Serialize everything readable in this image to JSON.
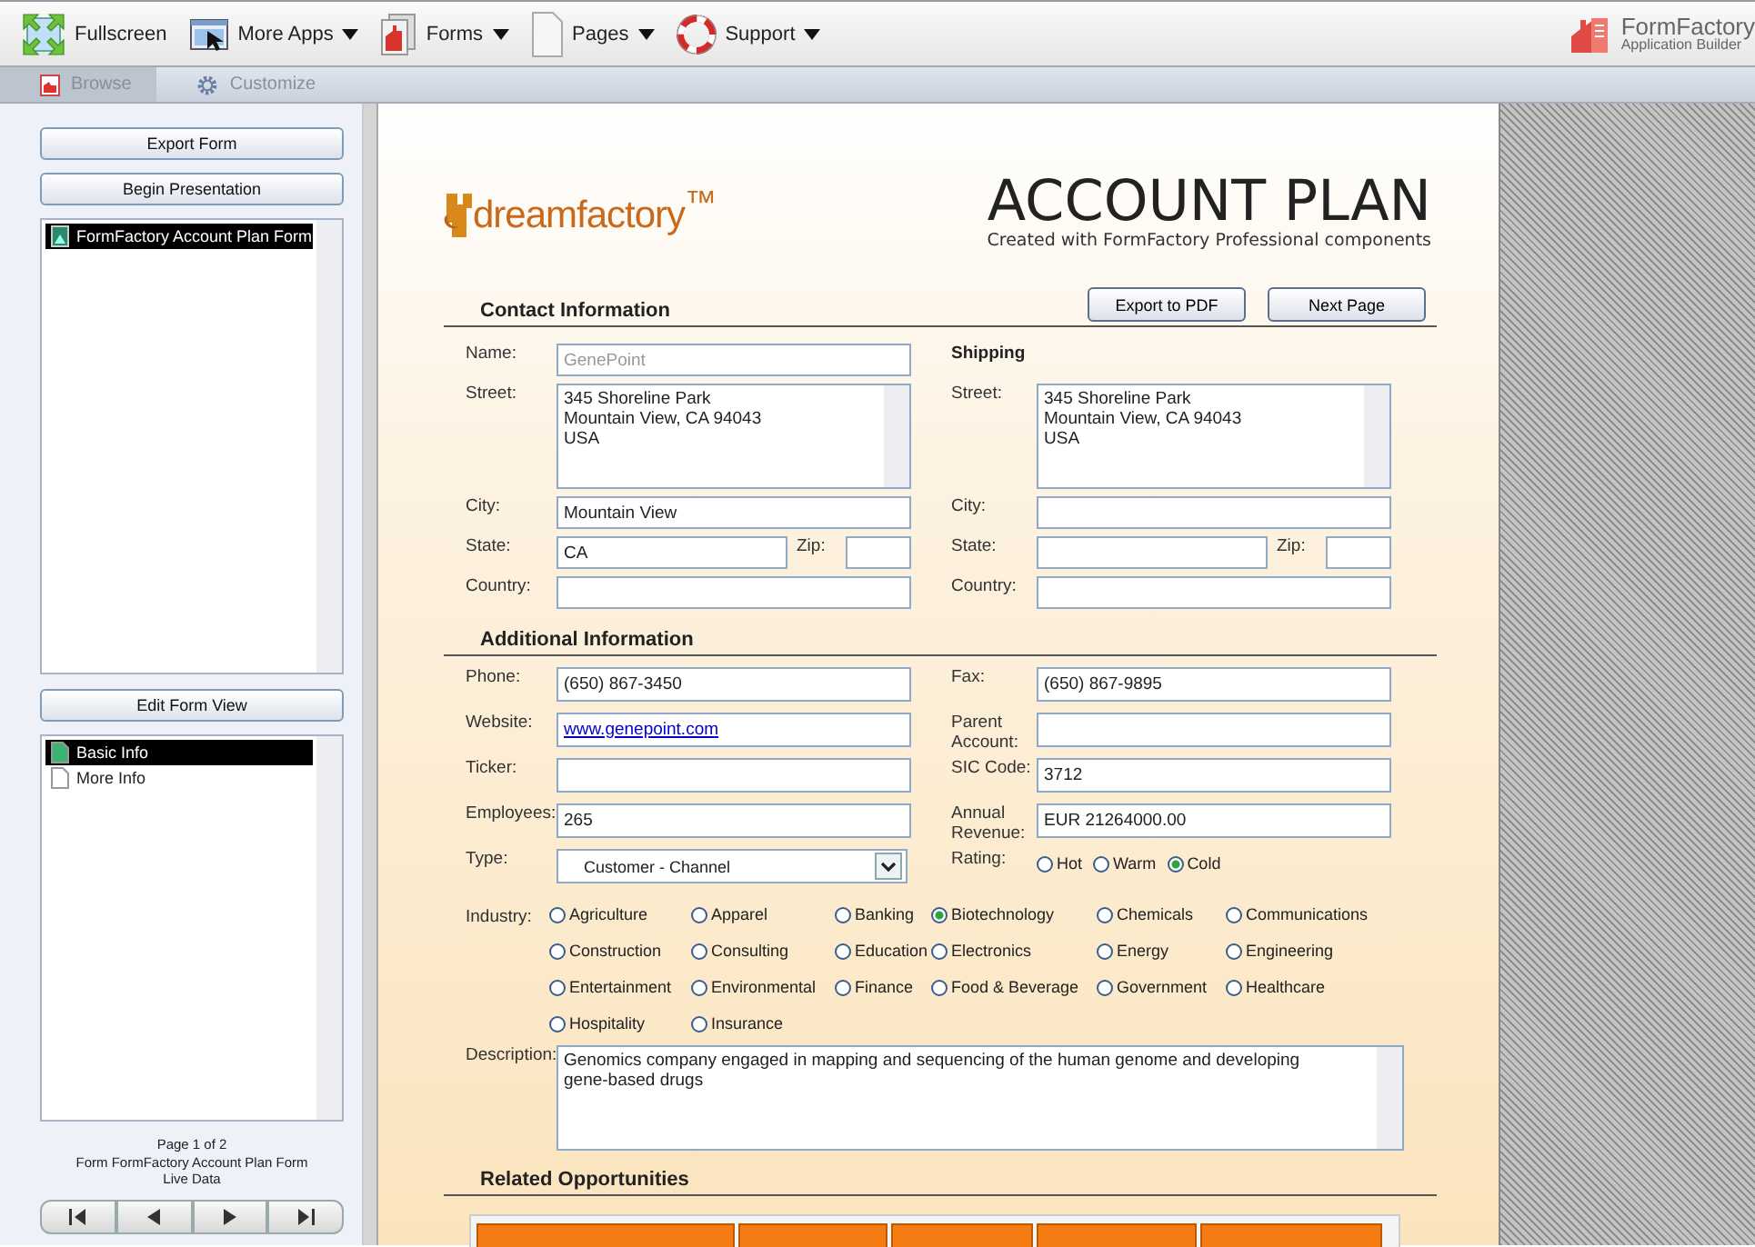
{
  "toolbar": {
    "items": [
      {
        "label": "Fullscreen",
        "kind": "button"
      },
      {
        "label": "More Apps",
        "kind": "menu"
      },
      {
        "label": "Forms",
        "kind": "menu"
      },
      {
        "label": "Pages",
        "kind": "menu"
      },
      {
        "label": "Support",
        "kind": "menu"
      }
    ],
    "brand": {
      "name": "FormFactory",
      "tagline": "Application Builder"
    }
  },
  "tabs": [
    {
      "label": "Browse",
      "selected": true
    },
    {
      "label": "Customize",
      "selected": false
    }
  ],
  "sidebar": {
    "form_actions": [
      "Export Form",
      "Begin Presentation"
    ],
    "forms": [
      {
        "label": "FormFactory Account Plan Form",
        "selected": true
      }
    ],
    "view_action": "Edit Form View",
    "pages": [
      {
        "label": "Basic Info",
        "selected": true
      },
      {
        "label": "More Info",
        "selected": false
      }
    ],
    "footer": [
      "Page 1 of 2",
      "Form FormFactory Account Plan Form",
      "Live Data"
    ]
  },
  "form": {
    "logo": "dreamfactory$^{™}$",
    "title": "ACCOUNT PLAN",
    "subtitle": "Created with FormFactory Professional components",
    "contact": {
      "heading": "Contact Information",
      "buttons": [
        "Export to PDF",
        "Next Page"
      ],
      "billing": [
        {
          "kind": "text",
          "label": "Name:",
          "placeholder": "GenePoint"
        },
        {
          "kind": "area",
          "label": "Street:",
          "value": "345 Shoreline Park\nMountain View, CA 94043\nUSA"
        },
        {
          "kind": "text",
          "label": "City:",
          "value": "Mountain View"
        },
        {
          "kind": "pair",
          "label": "State:",
          "value": "CA",
          "label2": "Zip:"
        },
        {
          "kind": "text",
          "label": "Country:"
        }
      ],
      "shipping_heading": "Shipping",
      "shipping": [
        {
          "kind": "area",
          "label": "Street:",
          "value": "345 Shoreline Park\nMountain View, CA 94043\nUSA"
        },
        {
          "kind": "text",
          "label": "City:"
        },
        {
          "kind": "pair",
          "label": "State:",
          "label2": "Zip:"
        },
        {
          "kind": "text",
          "label": "Country:"
        }
      ]
    },
    "additional": {
      "heading": "Additional Information",
      "left": [
        {
          "kind": "text",
          "label": "Phone:",
          "value": "(650) 867-3450"
        },
        {
          "kind": "link",
          "label": "Website:",
          "value": "www.genepoint.com"
        },
        {
          "kind": "text",
          "label": "Ticker:"
        },
        {
          "kind": "text",
          "label": "Employees:",
          "value": "265"
        }
      ],
      "right": [
        {
          "kind": "text",
          "label": "Fax:",
          "value": "(650) 867-9895"
        },
        {
          "kind": "text",
          "label": "Parent Account:"
        },
        {
          "kind": "text",
          "label": "SIC Code:",
          "value": "3712"
        },
        {
          "kind": "text",
          "label": "Annual Revenue:",
          "value": "EUR 21264000.00"
        }
      ],
      "type": {
        "label": "Type:",
        "value": "Customer - Channel"
      },
      "rating": {
        "label": "Rating:",
        "options": [
          {
            "label": "Hot",
            "selected": false
          },
          {
            "label": "Warm",
            "selected": false
          },
          {
            "label": "Cold",
            "selected": true
          }
        ]
      },
      "industry": {
        "label": "Industry:",
        "options": [
          {
            "label": "Agriculture",
            "selected": false
          },
          {
            "label": "Apparel",
            "selected": false
          },
          {
            "label": "Banking",
            "selected": false
          },
          {
            "label": "Biotechnology",
            "selected": true
          },
          {
            "label": "Chemicals",
            "selected": false
          },
          {
            "label": "Communications",
            "selected": false
          },
          {
            "label": "Construction",
            "selected": false
          },
          {
            "label": "Consulting",
            "selected": false
          },
          {
            "label": "Education",
            "selected": false
          },
          {
            "label": "Electronics",
            "selected": false
          },
          {
            "label": "Energy",
            "selected": false
          },
          {
            "label": "Engineering",
            "selected": false
          },
          {
            "label": "Entertainment",
            "selected": false
          },
          {
            "label": "Environmental",
            "selected": false
          },
          {
            "label": "Finance",
            "selected": false
          },
          {
            "label": "Food & Beverage",
            "selected": false
          },
          {
            "label": "Government",
            "selected": false
          },
          {
            "label": "Healthcare",
            "selected": false
          },
          {
            "label": "Hospitality",
            "selected": false
          },
          {
            "label": "Insurance",
            "selected": false
          }
        ]
      },
      "description": {
        "label": "Description:",
        "value": "Genomics company engaged in mapping and sequencing of the human genome and developing\ngene-based drugs"
      }
    },
    "related": {
      "heading": "Related Opportunities"
    }
  }
}
